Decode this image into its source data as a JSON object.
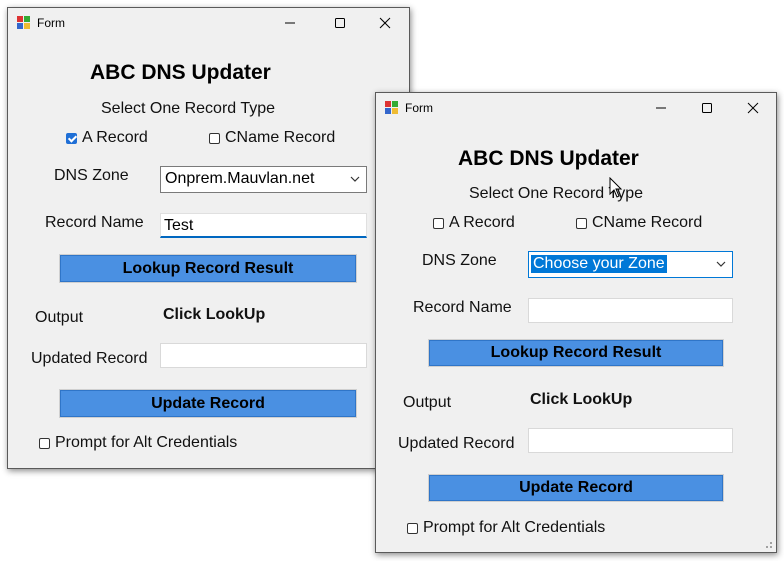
{
  "windows": [
    {
      "title": "Form",
      "heading": "ABC DNS Updater",
      "select_record_type": "Select One Record Type",
      "a_record_label": "A Record",
      "a_record_checked": true,
      "cname_record_label": "CName Record",
      "cname_record_checked": false,
      "dns_zone_label": "DNS Zone",
      "dns_zone_value": "Onprem.Mauvlan.net",
      "record_name_label": "Record Name",
      "record_name_value": "Test",
      "lookup_button": "Lookup Record Result",
      "output_label": "Output",
      "output_value": "Click LookUp",
      "updated_record_label": "Updated Record",
      "updated_record_value": "",
      "update_button": "Update Record",
      "alt_credentials_label": "Prompt for Alt Credentials",
      "alt_credentials_checked": false
    },
    {
      "title": "Form",
      "heading": "ABC DNS Updater",
      "select_record_type": "Select One Record Type",
      "a_record_label": "A Record",
      "a_record_checked": false,
      "cname_record_label": "CName Record",
      "cname_record_checked": false,
      "dns_zone_label": "DNS Zone",
      "dns_zone_value": "Choose your Zone",
      "record_name_label": "Record Name",
      "record_name_value": "",
      "lookup_button": "Lookup Record Result",
      "output_label": "Output",
      "output_value": "Click LookUp",
      "updated_record_label": "Updated Record",
      "updated_record_value": "",
      "update_button": "Update Record",
      "alt_credentials_label": "Prompt for Alt Credentials",
      "alt_credentials_checked": false
    }
  ],
  "colors": {
    "button_fill": "#4a90e2",
    "checkbox_checked": "#1f6fd6",
    "selection_highlight": "#0078d7",
    "window_background": "#f0f0f0"
  }
}
